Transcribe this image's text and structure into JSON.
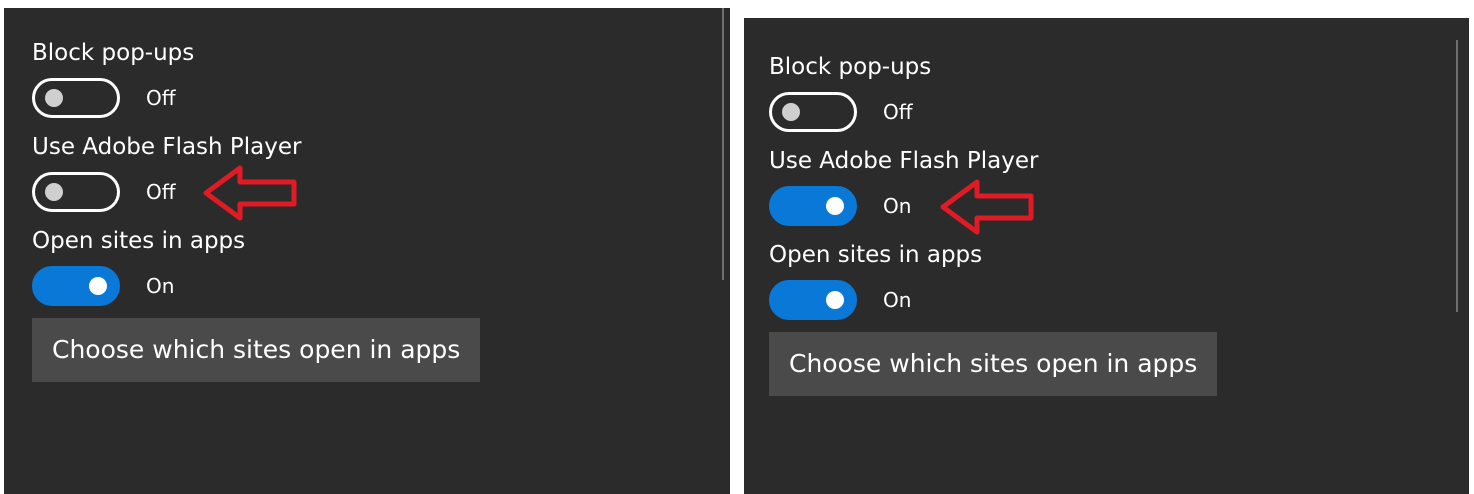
{
  "left_panel": {
    "block_popups": {
      "label": "Block pop-ups",
      "state": "Off"
    },
    "flash_player": {
      "label": "Use Adobe Flash Player",
      "state": "Off"
    },
    "open_sites_in_apps": {
      "label": "Open sites in apps",
      "state": "On"
    },
    "choose_button": "Choose which sites open in apps"
  },
  "right_panel": {
    "block_popups": {
      "label": "Block pop-ups",
      "state": "Off"
    },
    "flash_player": {
      "label": "Use Adobe Flash Player",
      "state": "On"
    },
    "open_sites_in_apps": {
      "label": "Open sites in apps",
      "state": "On"
    },
    "choose_button": "Choose which sites open in apps"
  },
  "annotation": {
    "icon": "red-arrow-icon",
    "color": "#e01b24"
  },
  "colors": {
    "panel_bg": "#2b2b2b",
    "toggle_on": "#0a78d7",
    "button_bg": "#4a4a4a"
  }
}
